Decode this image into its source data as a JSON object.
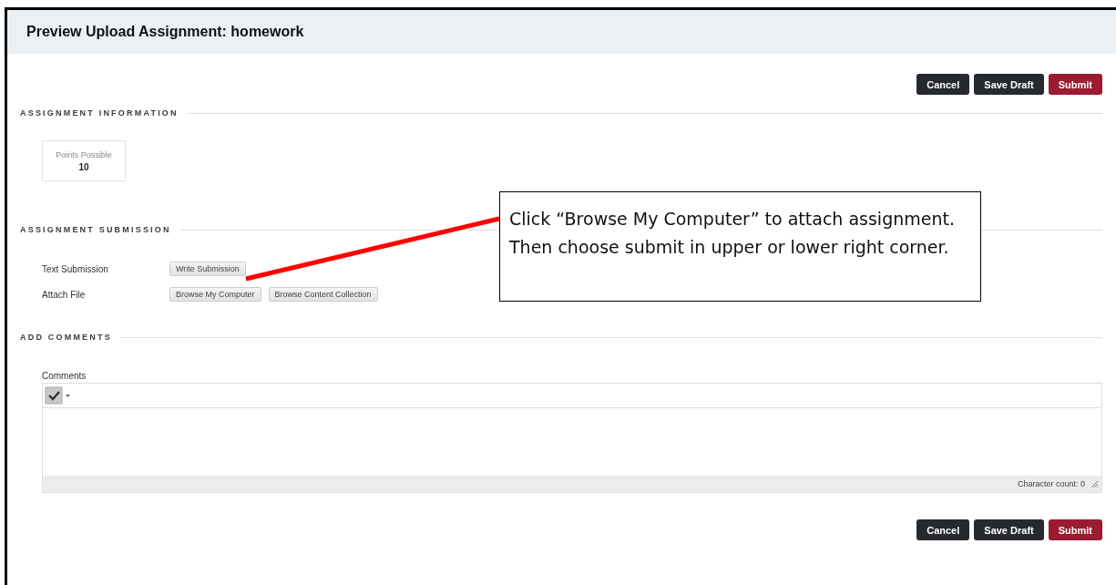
{
  "page": {
    "title": "Preview Upload Assignment: homework"
  },
  "top_actions": [
    {
      "label": "Cancel",
      "kind": "dark"
    },
    {
      "label": "Save Draft",
      "kind": "dark"
    },
    {
      "label": "Submit",
      "kind": "primary"
    }
  ],
  "assignment_information": {
    "heading": "ASSIGNMENT INFORMATION",
    "points_label": "Points Possible",
    "points": "10"
  },
  "assignment_submission": {
    "heading": "ASSIGNMENT SUBMISSION",
    "rows": [
      {
        "label": "Text Submission",
        "buttons": [
          "Write Submission"
        ]
      },
      {
        "label": "Attach File",
        "buttons": [
          "Browse My Computer",
          "Browse Content Collection"
        ]
      }
    ]
  },
  "add_comments": {
    "heading": "ADD COMMENTS",
    "field_label": "Comments",
    "character_count": "Character count: 0"
  },
  "bottom_actions": [
    {
      "label": "Cancel",
      "kind": "dark"
    },
    {
      "label": "Save Draft",
      "kind": "dark"
    },
    {
      "label": "Submit",
      "kind": "primary"
    }
  ],
  "callout": {
    "text": "Click “Browse My Computer” to attach assignment.  Then choose submit in upper or lower right corner."
  }
}
